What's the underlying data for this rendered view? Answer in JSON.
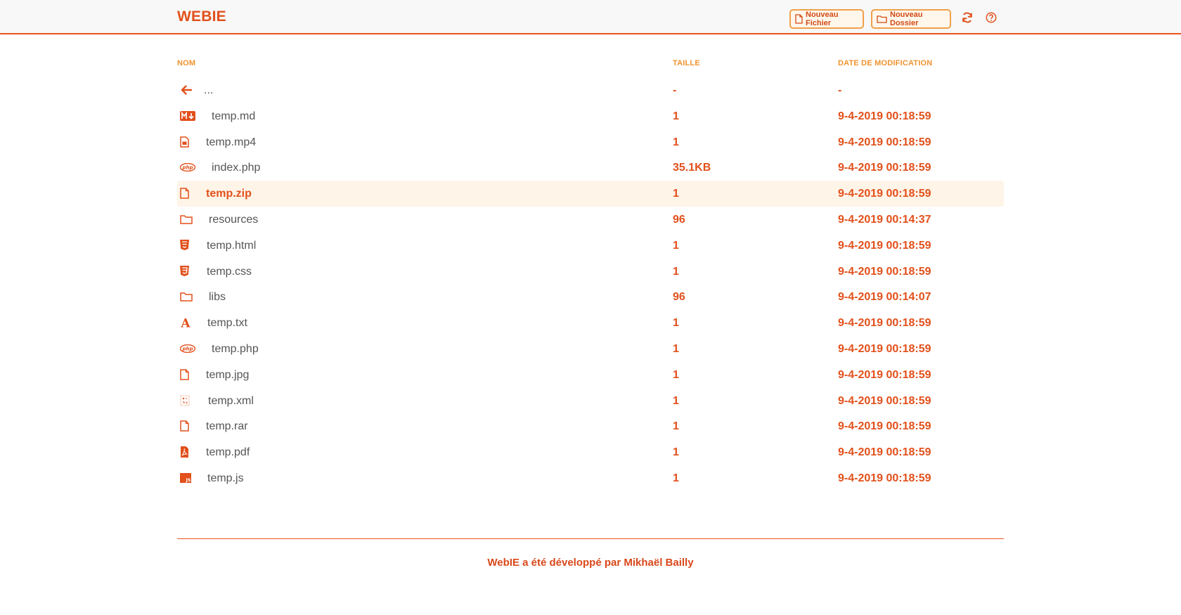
{
  "header": {
    "brand": "WEBIE",
    "new_file_label": "Nouveau Fichier",
    "new_folder_label": "Nouveau Dossier",
    "refresh_icon": "refresh-icon",
    "help_icon": "help-icon"
  },
  "table": {
    "columns": {
      "name": "NOM",
      "size": "TAILLE",
      "date": "DATE DE MODIFICATION"
    },
    "rows": [
      {
        "icon": "arrow-left-icon",
        "name": "...",
        "size": "-",
        "date": "-"
      },
      {
        "icon": "markdown-icon",
        "name": "temp.md",
        "size": "1",
        "date": "9-4-2019 00:18:59"
      },
      {
        "icon": "video-file-icon",
        "name": "temp.mp4",
        "size": "1",
        "date": "9-4-2019 00:18:59"
      },
      {
        "icon": "php-icon",
        "name": "index.php",
        "size": "35.1KB",
        "date": "9-4-2019 00:18:59"
      },
      {
        "icon": "file-icon",
        "name": "temp.zip",
        "size": "1",
        "date": "9-4-2019 00:18:59"
      },
      {
        "icon": "folder-icon",
        "name": "resources",
        "size": "96",
        "date": "9-4-2019 00:14:37"
      },
      {
        "icon": "html5-icon",
        "name": "temp.html",
        "size": "1",
        "date": "9-4-2019 00:18:59"
      },
      {
        "icon": "css3-icon",
        "name": "temp.css",
        "size": "1",
        "date": "9-4-2019 00:18:59"
      },
      {
        "icon": "folder-icon",
        "name": "libs",
        "size": "96",
        "date": "9-4-2019 00:14:07"
      },
      {
        "icon": "font-icon",
        "name": "temp.txt",
        "size": "1",
        "date": "9-4-2019 00:18:59"
      },
      {
        "icon": "php-icon",
        "name": "temp.php",
        "size": "1",
        "date": "9-4-2019 00:18:59"
      },
      {
        "icon": "file-icon",
        "name": "temp.jpg",
        "size": "1",
        "date": "9-4-2019 00:18:59"
      },
      {
        "icon": "xml-icon",
        "name": "temp.xml",
        "size": "1",
        "date": "9-4-2019 00:18:59"
      },
      {
        "icon": "file-icon",
        "name": "temp.rar",
        "size": "1",
        "date": "9-4-2019 00:18:59"
      },
      {
        "icon": "pdf-icon",
        "name": "temp.pdf",
        "size": "1",
        "date": "9-4-2019 00:18:59"
      },
      {
        "icon": "js-icon",
        "name": "temp.js",
        "size": "1",
        "date": "9-4-2019 00:18:59"
      }
    ],
    "highlighted_row": 4
  },
  "footer": {
    "text": "WebIE a été développé par Mikhaël Bailly"
  },
  "colors": {
    "accent": "#e2501b",
    "header_accent": "#f0922e",
    "highlight_bg": "#fff4e8"
  }
}
